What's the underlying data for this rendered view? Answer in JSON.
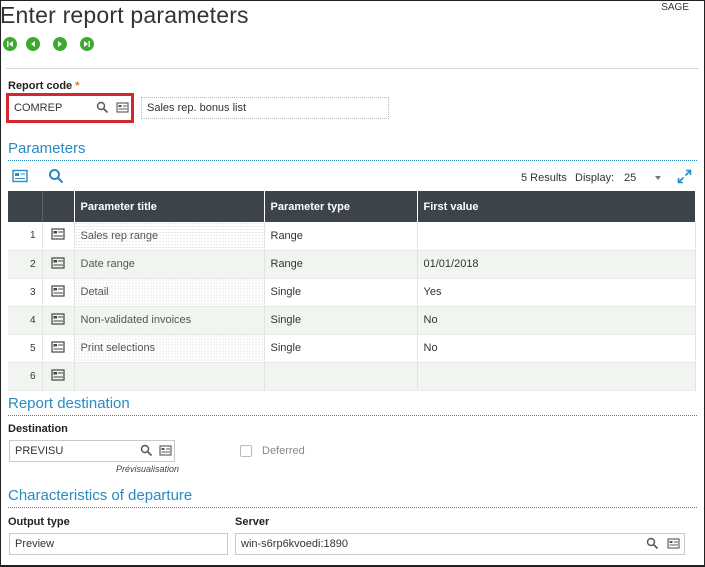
{
  "app": {
    "title": "Enter report parameters",
    "brand": "SAGE"
  },
  "nav": {
    "first": "first-record",
    "prev": "previous-record",
    "next": "next-record",
    "last": "last-record"
  },
  "report_code": {
    "label": "Report code",
    "required_mark": "*",
    "value": "COMREP",
    "description": "Sales rep. bonus list"
  },
  "parameters": {
    "section_title": "Parameters",
    "results": "5 Results",
    "display_label": "Display:",
    "display_value": "25",
    "columns": [
      "Parameter title",
      "Parameter type",
      "First value"
    ],
    "rows": [
      {
        "num": "1",
        "title": "Sales rep range",
        "type": "Range",
        "value": ""
      },
      {
        "num": "2",
        "title": "Date range",
        "type": "Range",
        "value": "01/01/2018"
      },
      {
        "num": "3",
        "title": "Detail",
        "type": "Single",
        "value": "Yes"
      },
      {
        "num": "4",
        "title": "Non-validated invoices",
        "type": "Single",
        "value": "No"
      },
      {
        "num": "5",
        "title": "Print selections",
        "type": "Single",
        "value": "No"
      },
      {
        "num": "6",
        "title": "",
        "type": "",
        "value": ""
      }
    ]
  },
  "destination": {
    "section_title": "Report destination",
    "label": "Destination",
    "value": "PREVISU",
    "caption": "Prévisualisation",
    "deferred_label": "Deferred"
  },
  "departure": {
    "section_title": "Characteristics of departure",
    "output_label": "Output type",
    "output_value": "Preview",
    "server_label": "Server",
    "server_value": "win-s6rp6kvoedi:1890"
  },
  "colors": {
    "accent": "#2a8ac4",
    "nav_green": "#3daa2f",
    "highlight": "#d0282e",
    "header": "#3d434a"
  }
}
